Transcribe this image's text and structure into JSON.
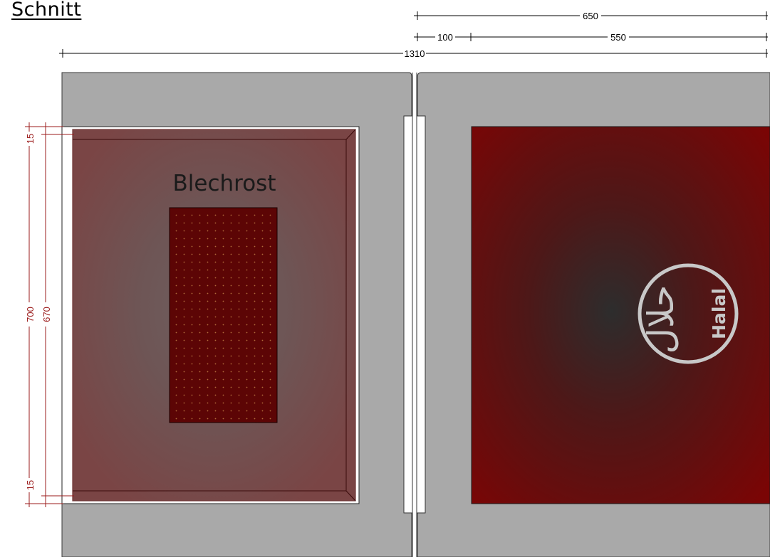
{
  "title": "Schnitt",
  "labels": {
    "rack": "Blechrost",
    "halal": "Halal",
    "halal_arabic": "حلال"
  },
  "dimensions": {
    "top_total": "650",
    "top_left": "100",
    "top_right": "550",
    "overall": "1310",
    "side_top_small": "15",
    "side_outer": "700",
    "side_inner": "670",
    "side_bottom_small": "15"
  },
  "colors": {
    "panel": "#a9a9a9",
    "rack_border": "#5a0a0a",
    "door_red": "#7a0000",
    "dim_red": "#9b1b1b",
    "dim_black": "#000000"
  }
}
